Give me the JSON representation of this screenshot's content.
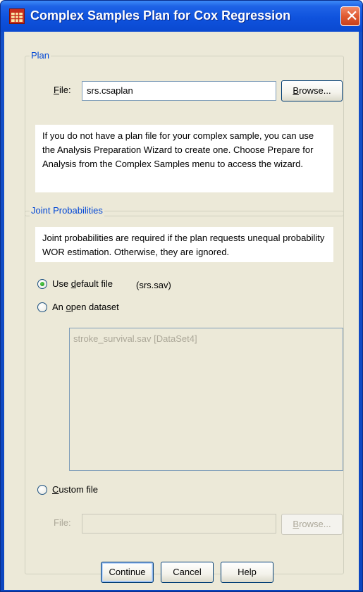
{
  "window": {
    "title": "Complex Samples Plan for Cox Regression",
    "close_glyph": "✕"
  },
  "plan": {
    "group_label": "Plan",
    "file_label_u": "F",
    "file_label_rest": "ile:",
    "file_value": "srs.csaplan",
    "browse_u": "B",
    "browse_rest": "rowse...",
    "info_text": "If you do not have a plan file for your complex sample, you can use the Analysis Preparation Wizard to create one. Choose Prepare for Analysis from the Complex Samples menu to access the wizard."
  },
  "joint": {
    "group_label": "Joint Probabilities",
    "info_text": "Joint probabilities are required if the plan requests unequal probability WOR estimation. Otherwise, they are ignored.",
    "option_default": {
      "pre": "Use ",
      "u": "d",
      "post": "efault file",
      "extra": "(srs.sav)",
      "checked": true
    },
    "option_open": {
      "pre": "An ",
      "u": "o",
      "post": "pen dataset",
      "checked": false
    },
    "datasets": [
      "stroke_survival.sav [DataSet4]"
    ],
    "option_custom": {
      "pre": "",
      "u": "C",
      "post": "ustom file",
      "checked": false
    },
    "custom_file_label_pre": "File",
    "custom_file_label_post": ":",
    "custom_file_value": "",
    "custom_browse_u": "B",
    "custom_browse_rest": "rowse..."
  },
  "buttons": {
    "continue": "Continue",
    "cancel": "Cancel",
    "help": "Help"
  },
  "colors": {
    "titlebar": "#0f52dd",
    "dialog_bg": "#ece9d8",
    "group_label": "#0046d5",
    "disabled_text": "#aca899"
  }
}
